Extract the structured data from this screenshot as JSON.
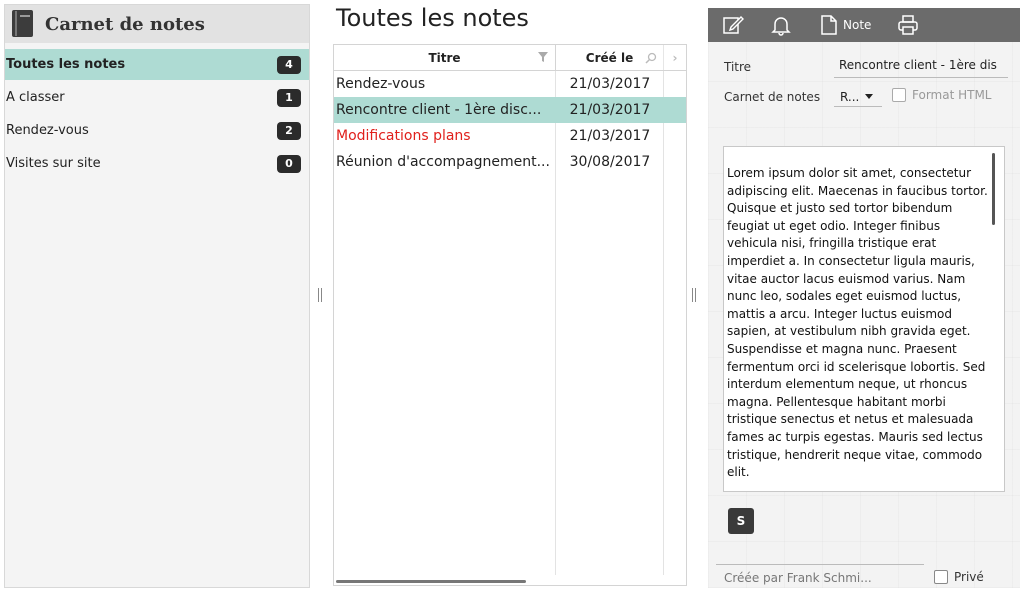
{
  "sidebar": {
    "title": "Carnet de notes",
    "items": [
      {
        "label": "Toutes les notes",
        "count": "4"
      },
      {
        "label": "A classer",
        "count": "1"
      },
      {
        "label": "Rendez-vous",
        "count": "2"
      },
      {
        "label": "Visites sur site",
        "count": "0"
      }
    ]
  },
  "list": {
    "title": "Toutes les notes",
    "columns": {
      "titre": "Titre",
      "cree": "Créé le"
    },
    "rows": [
      {
        "titre": "Rendez-vous",
        "cree": "21/03/2017"
      },
      {
        "titre": "Rencontre client - 1ère disc...",
        "cree": "21/03/2017"
      },
      {
        "titre": "Modifications plans",
        "cree": "21/03/2017"
      },
      {
        "titre": "Réunion d'accompagnement...",
        "cree": "30/08/2017"
      }
    ]
  },
  "detail": {
    "toolbar": {
      "note_label": "Note"
    },
    "titre_label": "Titre",
    "titre_value": "Rencontre client - 1ère dis",
    "carnet_label": "Carnet de notes",
    "carnet_value": "R...",
    "format_html_label": "Format HTML",
    "body": "Lorem ipsum dolor sit amet, consectetur adipiscing elit. Maecenas in faucibus tortor. Quisque et justo sed tortor bibendum feugiat ut eget odio. Integer finibus vehicula nisi, fringilla tristique erat imperdiet a. In consectetur ligula mauris, vitae auctor lacus euismod varius. Nam nunc leo, sodales eget euismod luctus, mattis a arcu. Integer luctus euismod sapien, at vestibulum nibh gravida eget. Suspendisse et magna nunc. Praesent fermentum orci id scelerisque lobortis. Sed interdum elementum neque, ut rhoncus magna. Pellentesque habitant morbi tristique senectus et netus et malesuada fames ac turpis egestas. Mauris sed lectus tristique, hendrerit neque vitae, commodo elit.",
    "s_button": "S",
    "created_by": "Créée par Frank Schmi...",
    "prive_label": "Privé"
  },
  "colors": {
    "accent_selection": "#aedbd3",
    "toolbar": "#6b6b6b",
    "badge": "#2b2b2b",
    "red_text": "#e0201c"
  },
  "icons": [
    "book-icon",
    "edit-icon",
    "bell-icon",
    "note-icon",
    "print-icon",
    "filter-icon",
    "search-icon"
  ]
}
